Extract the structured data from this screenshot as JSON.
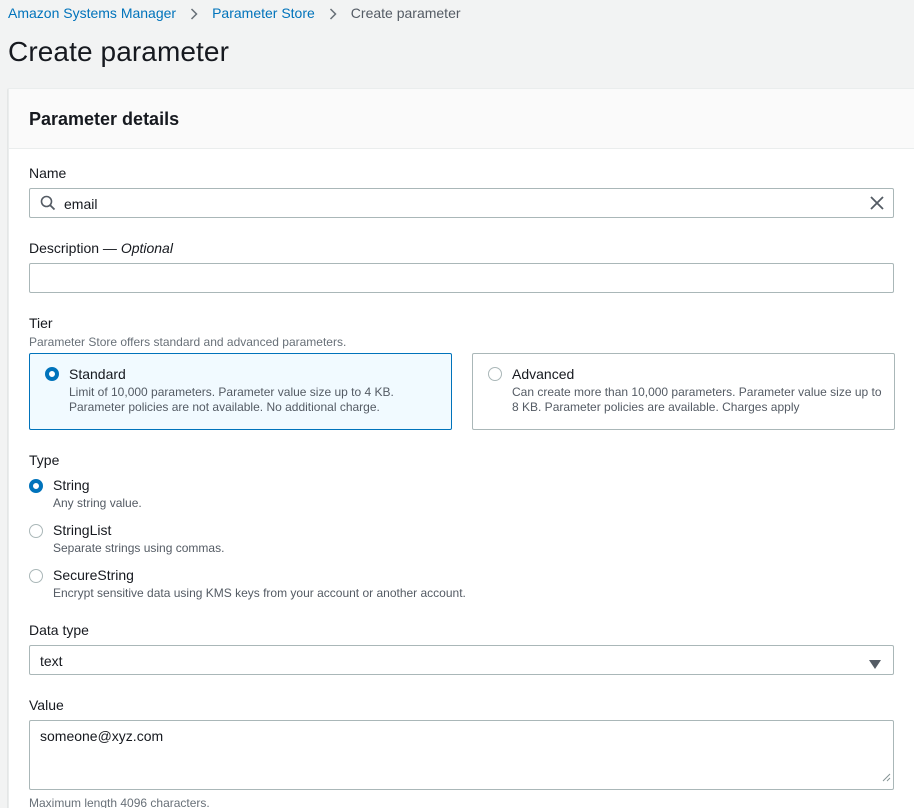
{
  "breadcrumb": {
    "items": [
      "Amazon Systems Manager",
      "Parameter Store"
    ],
    "current": "Create parameter"
  },
  "page": {
    "title": "Create parameter"
  },
  "panel": {
    "title": "Parameter details"
  },
  "name_field": {
    "label": "Name",
    "value": "email"
  },
  "description_field": {
    "label": "Description",
    "optional": "Optional",
    "separator": " — ",
    "value": ""
  },
  "tier": {
    "label": "Tier",
    "hint": "Parameter Store offers standard and advanced parameters.",
    "options": [
      {
        "title": "Standard",
        "desc": "Limit of 10,000 parameters. Parameter value size up to 4 KB. Parameter policies are not available. No additional charge.",
        "selected": true
      },
      {
        "title": "Advanced",
        "desc": "Can create more than 10,000 parameters. Parameter value size up to 8 KB. Parameter policies are available. Charges apply",
        "selected": false
      }
    ]
  },
  "type": {
    "label": "Type",
    "options": [
      {
        "title": "String",
        "desc": "Any string value.",
        "selected": true
      },
      {
        "title": "StringList",
        "desc": "Separate strings using commas.",
        "selected": false
      },
      {
        "title": "SecureString",
        "desc": "Encrypt sensitive data using KMS keys from your account or another account.",
        "selected": false
      }
    ]
  },
  "data_type": {
    "label": "Data type",
    "value": "text"
  },
  "value_field": {
    "label": "Value",
    "value": "someone@xyz.com",
    "hint": "Maximum length 4096 characters."
  },
  "colors": {
    "link": "#0073bb",
    "selected_bg": "#f1faff",
    "border": "#aab7b8",
    "page_bg": "#f2f3f3"
  },
  "icons": {
    "breadcrumb_separator": "chevron-right-icon",
    "search": "search-icon",
    "clear": "close-icon",
    "dropdown": "caret-down-icon"
  }
}
